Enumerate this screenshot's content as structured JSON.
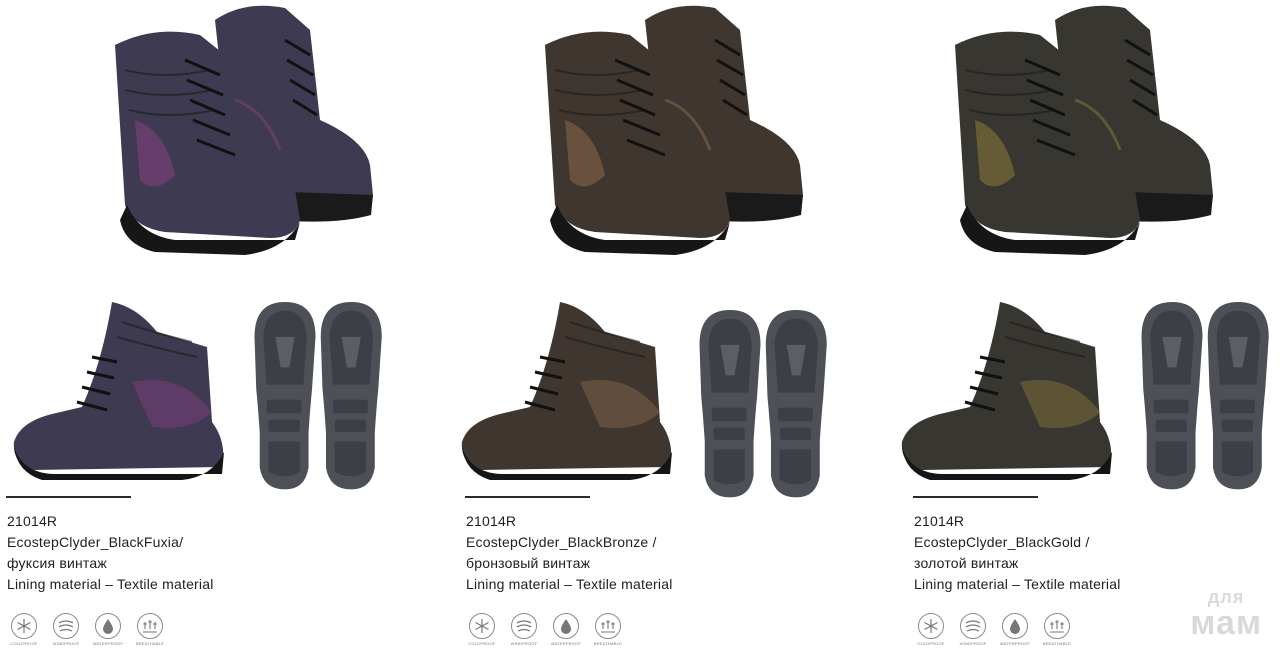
{
  "products": [
    {
      "code": "21014R",
      "name": "EcostepClyder_BlackFuxia/",
      "color_ru": "фуксия винтаж",
      "lining": "Lining material – Textile material",
      "boot_color": "#3d3a52",
      "accent_color": "#8a3f80"
    },
    {
      "code": "21014R",
      "name": "EcostepClyder_BlackBronze /",
      "color_ru": "бронзовый винтаж",
      "lining": "Lining material – Textile material",
      "boot_color": "#3f3630",
      "accent_color": "#8a6a4a"
    },
    {
      "code": "21014R",
      "name": "EcostepClyder_BlackGold /",
      "color_ru": "золотой винтаж",
      "lining": "Lining material – Textile material",
      "boot_color": "#383630",
      "accent_color": "#8a7a3a"
    }
  ],
  "features": [
    {
      "label": "COLDPROOF",
      "icon": "snowflake-icon"
    },
    {
      "label": "WINDPROOF",
      "icon": "wind-icon"
    },
    {
      "label": "WATERPROOF",
      "icon": "water-drop-icon"
    },
    {
      "label": "BREATHABLE",
      "icon": "breathable-icon"
    }
  ],
  "watermark": {
    "line1": "для",
    "line2": "мам"
  }
}
